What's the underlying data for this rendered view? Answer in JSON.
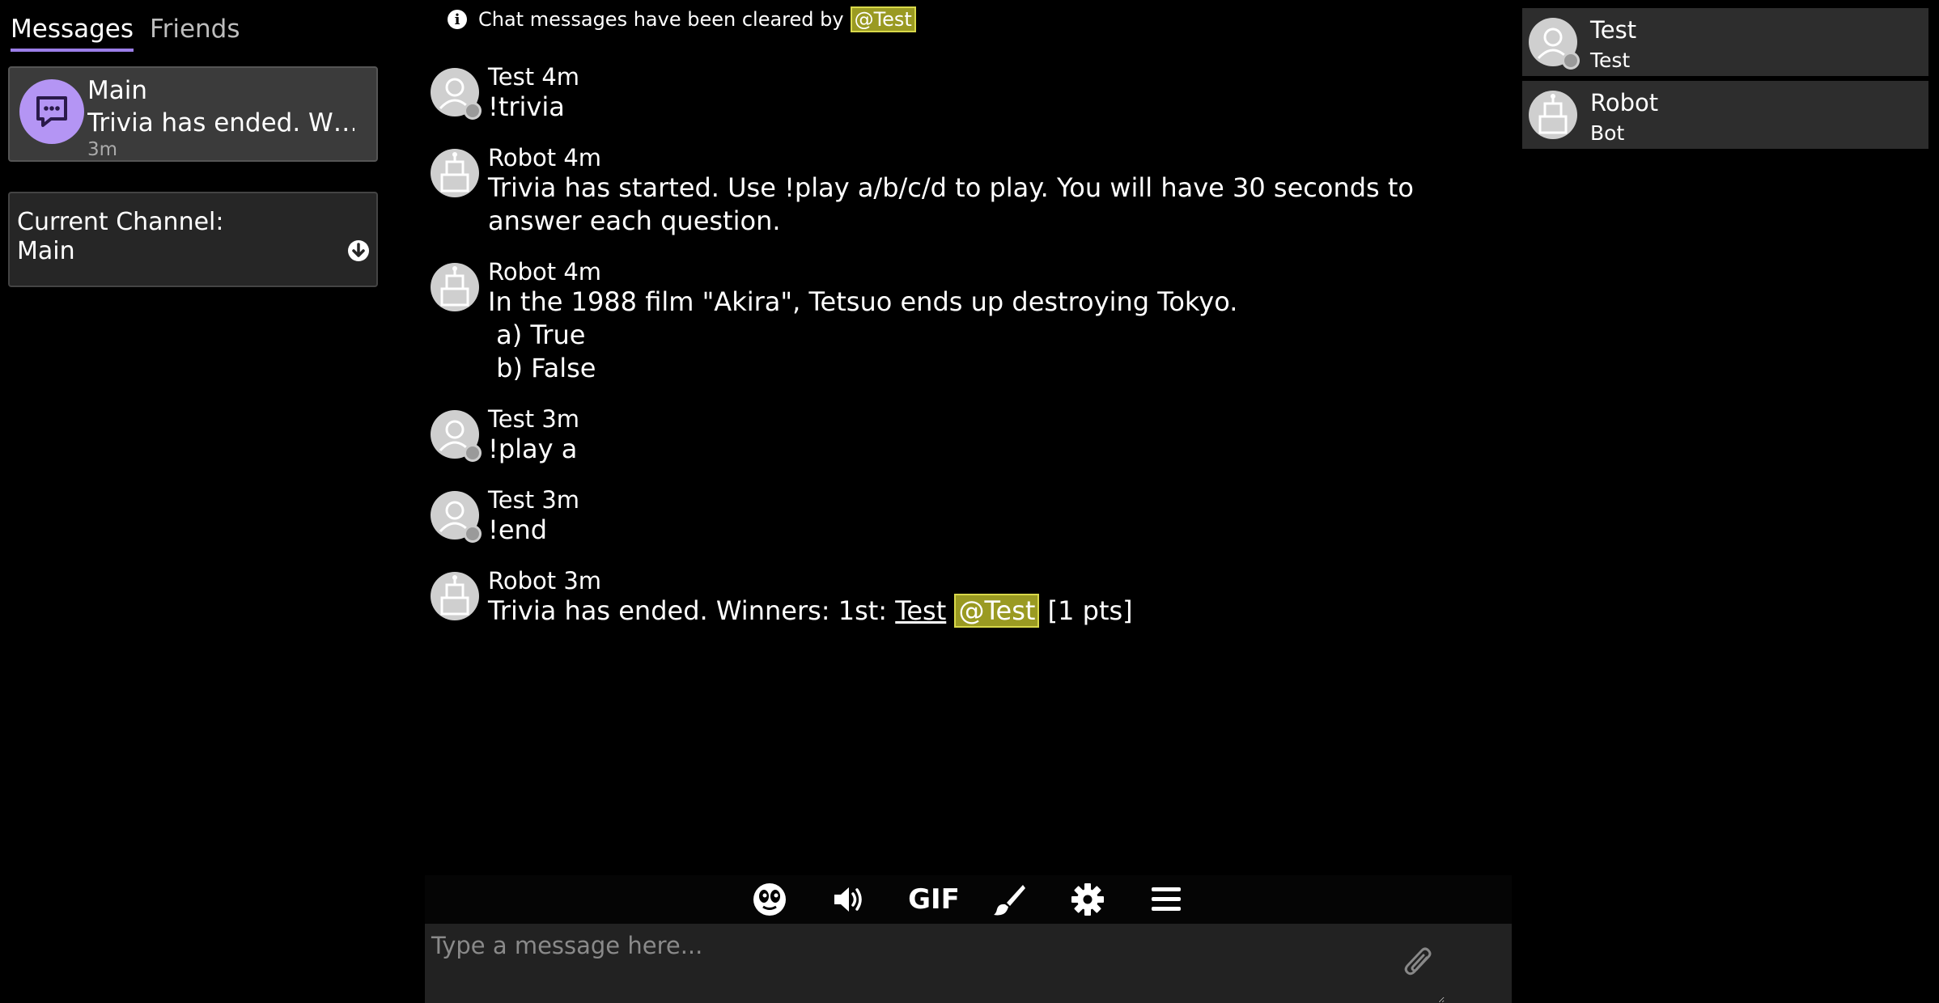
{
  "tabs": [
    {
      "label": "Messages"
    },
    {
      "label": "Friends"
    }
  ],
  "channel": {
    "name": "Main",
    "last_message": "Trivia has ended. W…",
    "time": "3m"
  },
  "current_channel": {
    "label": "Current Channel:",
    "value": "Main"
  },
  "notice": {
    "text": "Chat messages have been cleared by",
    "mention": "@Test"
  },
  "messages": [
    {
      "author": "Test",
      "time": "4m",
      "body": "!trivia",
      "avatar": "user-icon"
    },
    {
      "author": "Robot",
      "time": "4m",
      "body": "Trivia has started. Use !play a/b/c/d to play. You will have 30 seconds to answer each question.",
      "avatar": "robot-icon"
    },
    {
      "author": "Robot",
      "time": "4m",
      "body": "In the 1988 film \"Akira\", Tetsuo ends up destroying Tokyo.",
      "options": [
        " a) True",
        " b) False"
      ],
      "avatar": "robot-icon"
    },
    {
      "author": "Test",
      "time": "3m",
      "body": "!play a",
      "avatar": "user-icon"
    },
    {
      "author": "Test",
      "time": "3m",
      "body": "!end",
      "avatar": "user-icon"
    },
    {
      "author": "Robot",
      "time": "3m",
      "body_prefix": "Trivia has ended. Winners: 1st: ",
      "winner_name": "Test",
      "winner_mention": "@Test",
      "body_suffix": " [1 pts]",
      "avatar": "robot-icon"
    }
  ],
  "toolbar": {
    "emoji": "emoji-icon",
    "sound": "volume-icon",
    "gif_label": "GIF",
    "paint": "brush-icon",
    "settings": "gear-icon",
    "menu": "menu-icon"
  },
  "input": {
    "placeholder": "Type a message here...",
    "value": ""
  },
  "members": [
    {
      "name": "Test",
      "subtitle": "Test",
      "avatar": "user-icon"
    },
    {
      "name": "Robot",
      "subtitle": "Bot",
      "avatar": "robot-icon"
    }
  ],
  "colors": {
    "accent": "#9b7ee8",
    "channel_icon": "#b495f4",
    "mention_bg": "#9a9a22",
    "mention_border": "#d8d84a"
  }
}
